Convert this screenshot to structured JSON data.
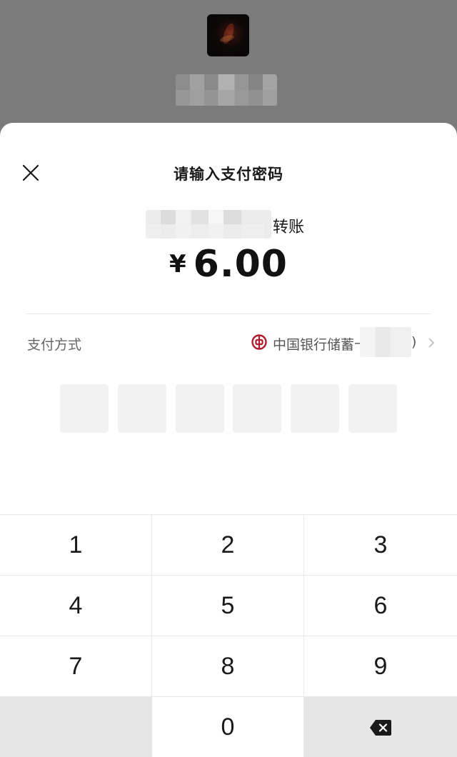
{
  "sheet": {
    "title": "请输入支付密码",
    "payee_suffix": "转账",
    "currency_symbol": "¥",
    "amount": "6.00"
  },
  "payment_method": {
    "label": "支付方式",
    "bank_name": "中国银行储蓄卡",
    "bank_suffix": ")",
    "bank_color": "#b01c2e"
  },
  "pin": {
    "length": 6
  },
  "keypad": {
    "keys": [
      "1",
      "2",
      "3",
      "4",
      "5",
      "6",
      "7",
      "8",
      "9",
      "0"
    ],
    "delete_icon": "backspace-icon"
  },
  "icons": {
    "close": "close-icon",
    "chevron": "chevron-right-icon",
    "bank": "bank-of-china-icon"
  }
}
